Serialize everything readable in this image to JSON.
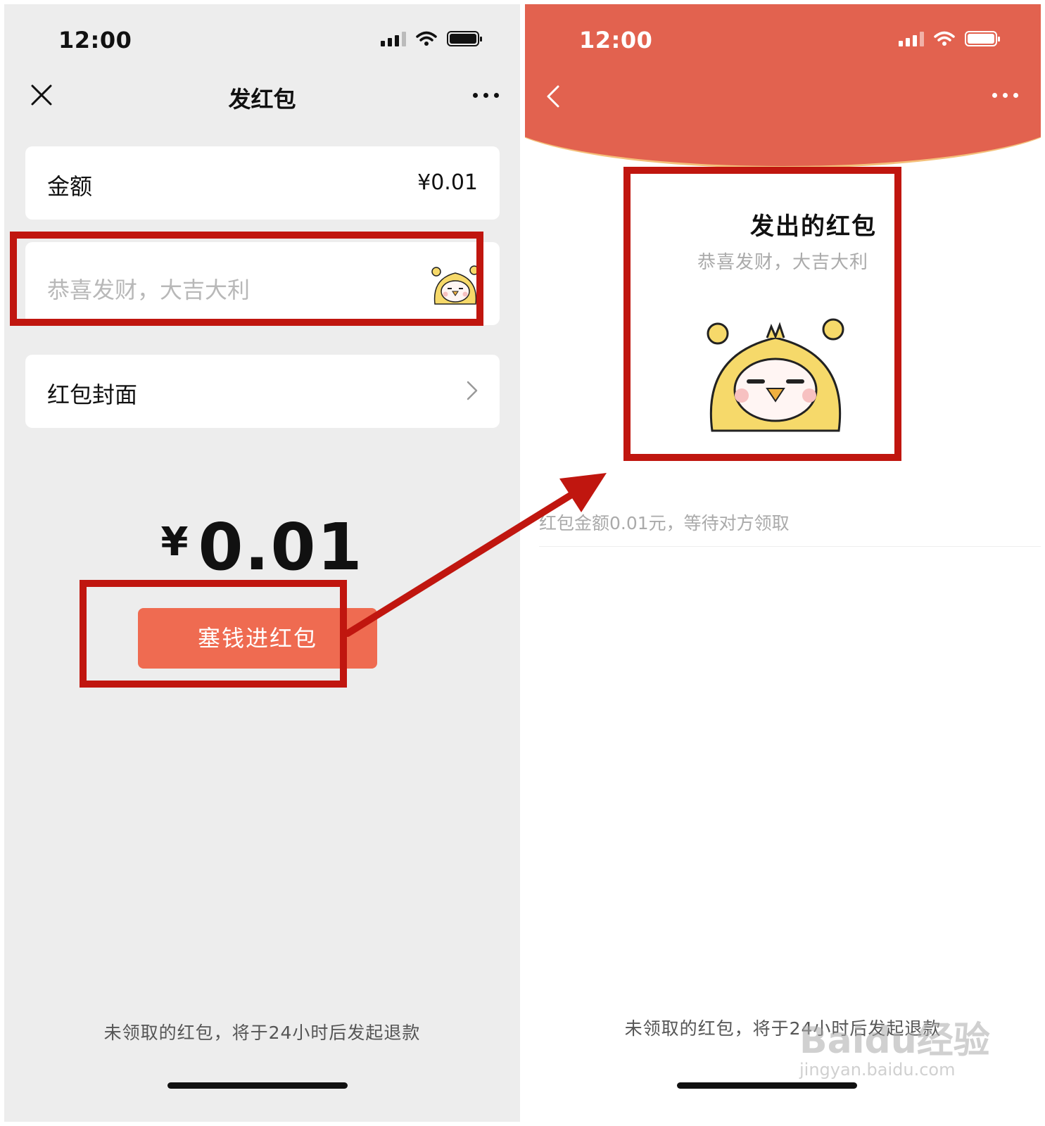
{
  "left_screen": {
    "status_time": "12:00",
    "title": "发红包",
    "amount_label": "金额",
    "amount_value": "¥0.01",
    "greeting_placeholder": "恭喜发财，大吉大利",
    "cover_label": "红包封面",
    "total_currency": "¥",
    "total_value": "0.01",
    "send_button": "塞钱进红包",
    "footer_note": "未领取的红包，将于24小时后发起退款"
  },
  "right_screen": {
    "status_time": "12:00",
    "title": "发出的红包",
    "greeting": "恭喜发财，大吉大利",
    "status_text": "红包金额0.01元，等待对方领取",
    "footer_note": "未领取的红包，将于24小时后发起退款"
  },
  "watermark": {
    "brand": "Baidu经验",
    "url": "jingyan.baidu.com"
  },
  "colors": {
    "accent": "#ef6b51",
    "header_red": "#e2624f",
    "annotation": "#c0160f",
    "background_gray": "#ededed"
  }
}
